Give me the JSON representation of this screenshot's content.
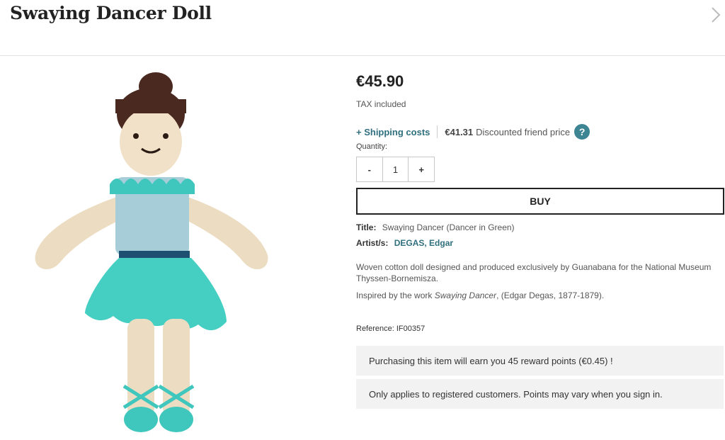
{
  "product": {
    "title": "Swaying Dancer Doll",
    "price": "€45.90",
    "tax_note": "TAX included",
    "shipping_link": "+ Shipping costs",
    "friend_price": "€41.31",
    "friend_label": "Discounted friend price",
    "help_icon": "?",
    "quantity_label": "Quantity:",
    "quantity_minus": "-",
    "quantity_value": "1",
    "quantity_plus": "+",
    "buy_label": "BUY",
    "title_label": "Title:",
    "title_value": "Swaying Dancer (Dancer in Green)",
    "artist_label": "Artist/s:",
    "artist_value": "DEGAS, Edgar",
    "description_1": "Woven cotton doll designed and produced exclusively by Guanabana for the National Museum Thyssen-Bornemisza.",
    "description_2_prefix": "Inspired by the work ",
    "description_2_work": "Swaying Dancer",
    "description_2_suffix": ", (Edgar Degas, 1877-1879).",
    "reference": "Reference: IF00357",
    "reward_note": "Purchasing this item will earn you 45 reward points (€0.45) !",
    "registered_note": "Only applies to registered customers. Points may vary when you sign in."
  },
  "icons": {
    "next": "chevron-right-icon",
    "help": "question-icon"
  },
  "colors": {
    "link": "#2f6f7e",
    "help_badge": "#3e8594",
    "info_box_bg": "#f2f2f2"
  }
}
